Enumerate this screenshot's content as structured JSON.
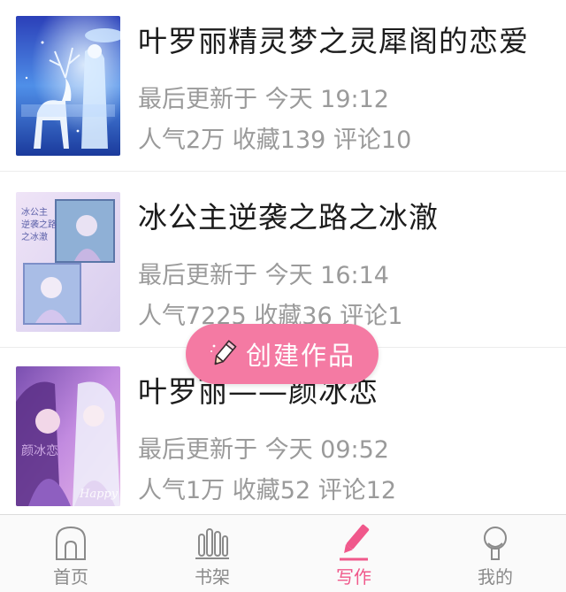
{
  "works": [
    {
      "title": "叶罗丽精灵梦之灵犀阁的恋爱",
      "updated": "最后更新于 今天 19:12",
      "popularity": "人气2万",
      "favorites": "收藏139",
      "comments": "评论10",
      "cover_icon": "cover-image-deer-fairy"
    },
    {
      "title": "冰公主逆袭之路之冰澈",
      "updated": "最后更新于 今天 16:14",
      "popularity": "人气7225",
      "favorites": "收藏36",
      "comments": "评论1",
      "cover_icon": "cover-image-ice-princess"
    },
    {
      "title": "叶罗丽——颜冰恋",
      "updated": "最后更新于 今天 09:52",
      "popularity": "人气1万",
      "favorites": "收藏52",
      "comments": "评论12",
      "cover_icon": "cover-image-couple"
    }
  ],
  "fab": {
    "label": "创建作品",
    "icon": "pencil-icon",
    "color": "#f47aa3"
  },
  "tabbar": {
    "active_color": "#f0588b",
    "inactive_color": "#8a8a8a",
    "tabs": [
      {
        "label": "首页",
        "icon": "home-icon",
        "active": false
      },
      {
        "label": "书架",
        "icon": "bookshelf-icon",
        "active": false
      },
      {
        "label": "写作",
        "icon": "pen-icon",
        "active": true
      },
      {
        "label": "我的",
        "icon": "profile-icon",
        "active": false
      }
    ]
  }
}
